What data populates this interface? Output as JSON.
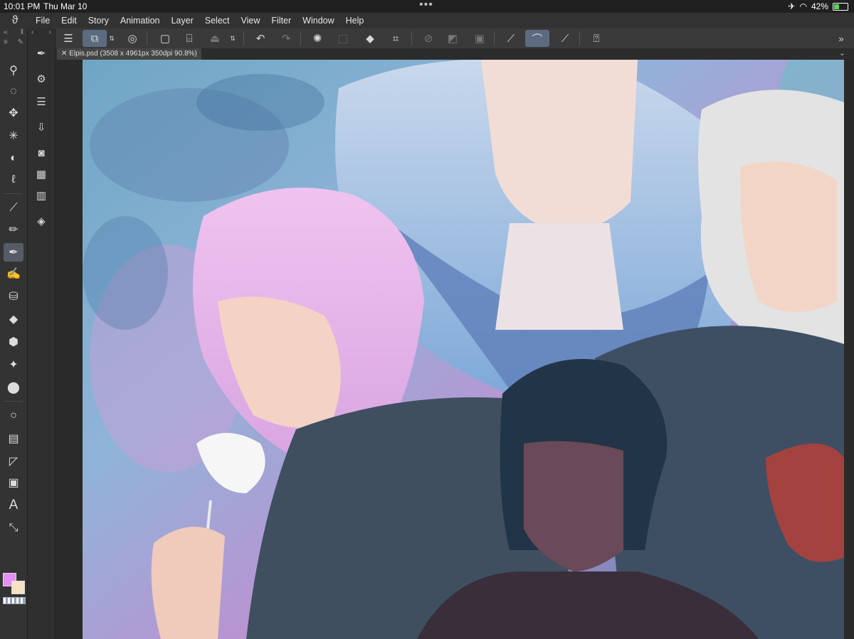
{
  "status": {
    "time": "10:01 PM",
    "date": "Thu Mar 10",
    "battery": "42%"
  },
  "menubar": {
    "items": [
      "File",
      "Edit",
      "Story",
      "Animation",
      "Layer",
      "Select",
      "View",
      "Filter",
      "Window",
      "Help"
    ]
  },
  "document": {
    "tab_label": "Elpis.psd (3508 x 4961px 350dpi 90.8%)"
  },
  "colors": {
    "main": "#e58ef5",
    "sub": "#f6e2c2",
    "active_tool_bg": "#5d6b80"
  },
  "commands": [
    "menu-icon",
    "canvas-mode-icon",
    "spiral-icon",
    "new-file-icon",
    "open-folder-icon",
    "save-icon",
    "stepper-icon",
    "undo-icon",
    "redo-icon",
    "loading-icon",
    "select-all-icon",
    "fill-icon",
    "transform-icon",
    "deselect-icon",
    "invert-icon",
    "border-icon",
    "ruler-icon",
    "brush-icon",
    "pen-icon",
    "help-icon"
  ],
  "tools": [
    "zoom-icon",
    "rotate-icon",
    "move-icon",
    "wand-icon",
    "select-icon",
    "lasso-icon",
    "eyedropper-icon",
    "pen-icon",
    "brush-icon",
    "airbrush-icon",
    "decorate-icon",
    "fill-icon",
    "eraser-icon",
    "sparkle-icon",
    "blend-icon",
    "circle-icon",
    "frame-icon",
    "ruler-icon",
    "gradient-icon",
    "text-icon",
    "operation-icon"
  ]
}
